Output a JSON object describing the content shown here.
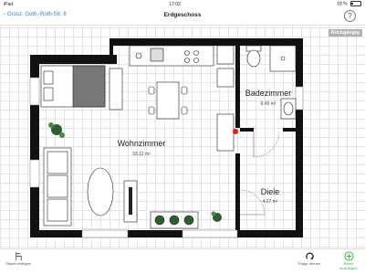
{
  "status": {
    "device": "iPad",
    "time": "17:02",
    "battery": "18 %"
  },
  "nav": {
    "back_label": "Grosz. Goth.-Roth-Str. 8",
    "title": "Erdgeschoss",
    "help": "?"
  },
  "undo_label": "Rückgängig",
  "rooms": {
    "wohnzimmer": {
      "name": "Wohnzimmer",
      "area": "33.12 m²"
    },
    "badezimmer": {
      "name": "Badezimmer",
      "area": "6.49 m²"
    },
    "diele": {
      "name": "Diele",
      "area": "4.07 m²"
    }
  },
  "toolbar": {
    "add_object": "Objekt einfügen",
    "rotate_floor": "Etage drehen",
    "room_add": "Raum hinzufügen"
  },
  "colors": {
    "wall": "#111111",
    "link": "#2f7fc1",
    "accent_green": "#3cb043",
    "door_marker": "#e02020",
    "plant": "#2e5e2e"
  }
}
